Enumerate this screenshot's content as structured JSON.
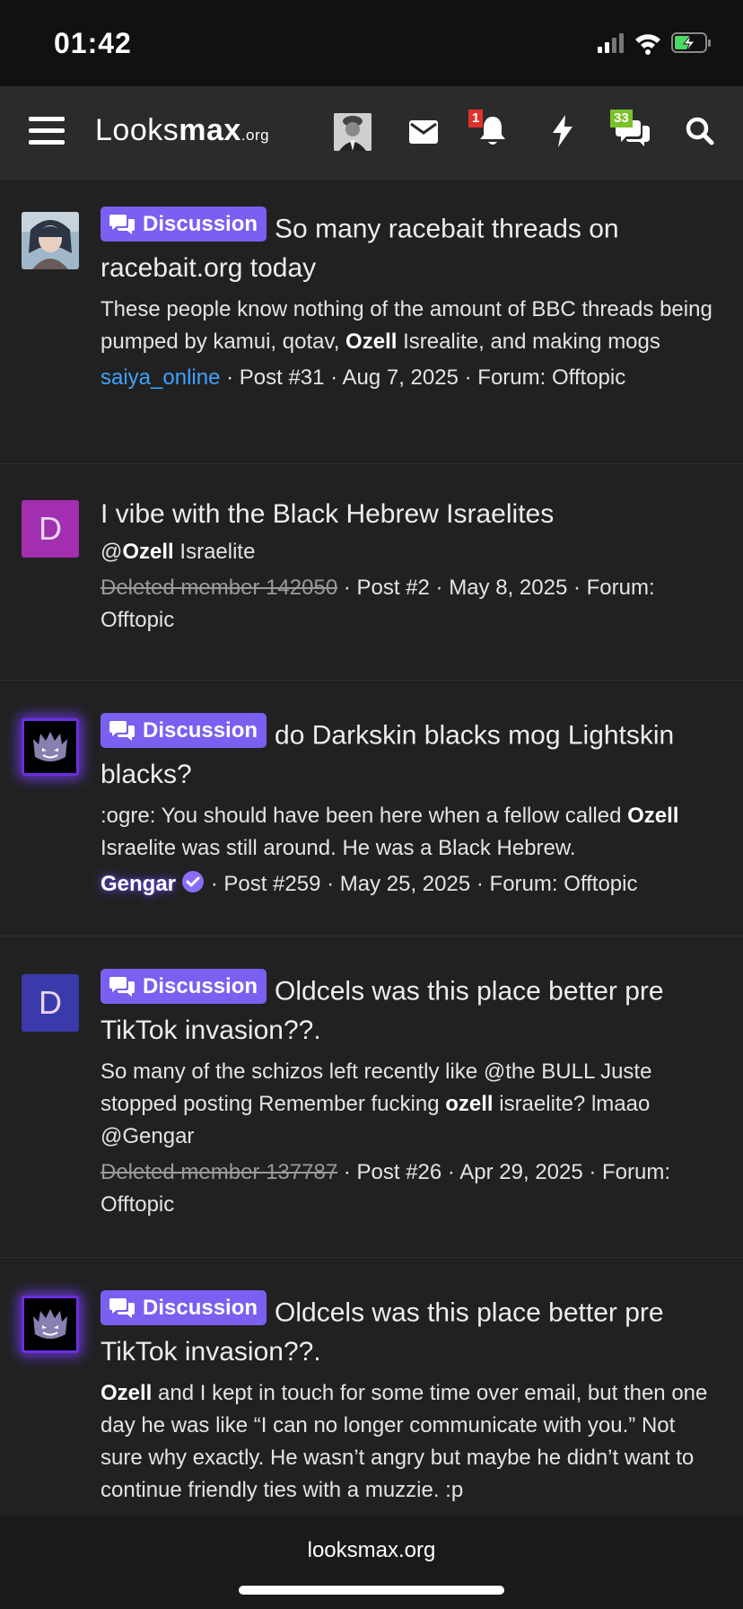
{
  "status": {
    "time": "01:42"
  },
  "header": {
    "logo": {
      "part1": "Looks",
      "part2": "max",
      "tld": ".org"
    },
    "notification_count": "1",
    "conversation_count": "33"
  },
  "results": [
    {
      "label": "Discussion",
      "title": "So many racebait threads on racebait.org today",
      "snippet": {
        "before": "These people know nothing of the amount of BBC threads being pumped by kamui, qotav, ",
        "bold": "Ozell",
        "after": " Isrealite, and making mogs"
      },
      "author": "saiya_online",
      "meta_rest": " · Post #31 · Aug 7, 2025 · Forum: Offtopic"
    },
    {
      "label": "",
      "title": "I vibe with the Black Hebrew Israelites",
      "avatar_letter": "D",
      "snippet": {
        "before": "@",
        "bold": "Ozell",
        "after": " Israelite"
      },
      "author": "Deleted member 142050",
      "meta_rest": " · Post #2 · May 8, 2025 · Forum: Offtopic"
    },
    {
      "label": "Discussion",
      "title": "do Darkskin blacks mog Lightskin blacks?",
      "snippet": {
        "before": ":ogre: You should have been here when a fellow called ",
        "bold": "Ozell",
        "after": " Israelite was still around. He was a Black Hebrew."
      },
      "author": "Gengar",
      "meta_rest": " · Post #259 · May 25, 2025 · Forum: Offtopic"
    },
    {
      "label": "Discussion",
      "title": "Oldcels was this place better pre TikTok invasion??.",
      "avatar_letter": "D",
      "snippet": {
        "before": "So many of the schizos left recently like @the BULL Juste stopped posting Remember fucking ",
        "bold": "ozell",
        "after": " israelite? lmaao @Gengar"
      },
      "author": "Deleted member 137787",
      "meta_rest": " · Post #26 · Apr 29, 2025 · Forum: Offtopic"
    },
    {
      "label": "Discussion",
      "title": "Oldcels was this place better pre TikTok invasion??.",
      "snippet": {
        "before": "",
        "bold": "Ozell",
        "after": " and I kept in touch for some time over email, but then one day he was like “I can no longer communicate with you.” Not sure why exactly. He wasn’t angry but maybe he didn’t want to continue friendly ties with a muzzie. :p"
      }
    }
  ],
  "footer": {
    "domain": "looksmax.org"
  },
  "colors": {
    "accent": "#7b5ff0",
    "link_blue": "#3ea2ff",
    "avatar_d_purple": "#a12fb0",
    "avatar_d_blue": "#3a3aaa",
    "badge_red": "#e0322c",
    "badge_green": "#7cc12a"
  }
}
